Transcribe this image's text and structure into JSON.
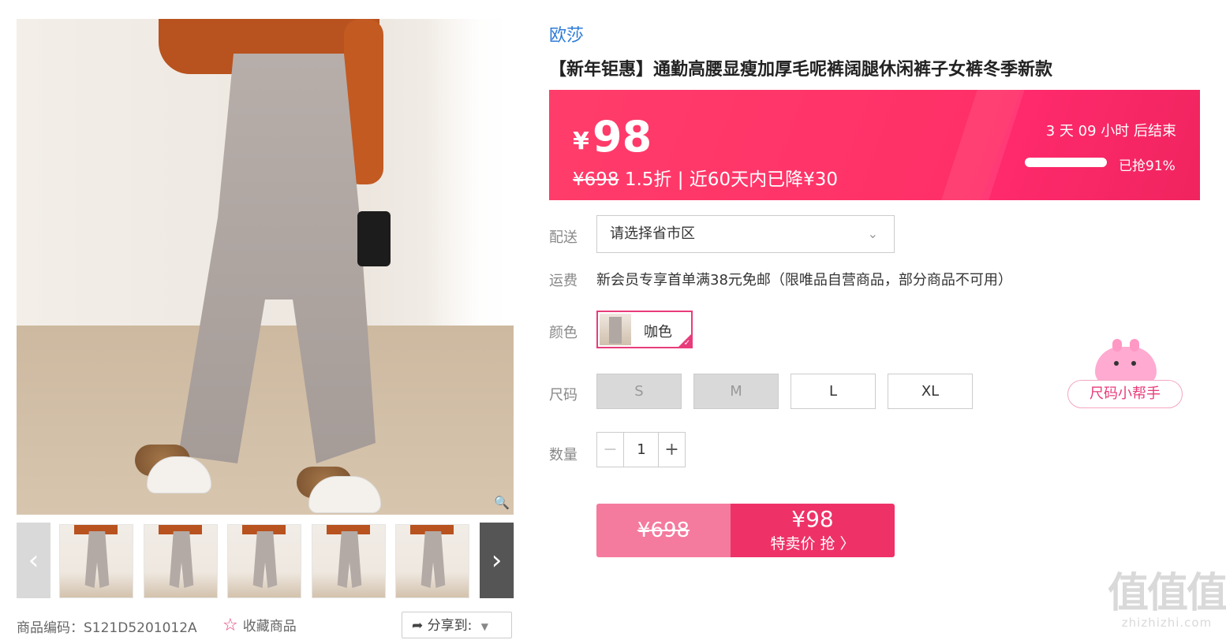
{
  "product": {
    "brand": "欧莎",
    "title": "【新年钜惠】通勤高腰显瘦加厚毛呢裤阔腿休闲裤子女裤冬季新款",
    "sku_label": "商品编码：S121D5201012A",
    "favorite_label": "收藏商品",
    "share_label": "分享到:"
  },
  "price": {
    "currency_symbol": "¥",
    "current": "98",
    "original": "¥698",
    "discount_text": " 1.5折 | 近60天内已降¥30",
    "countdown": "3 天 09 小时 后结束",
    "grabbed_text": "已抢91%",
    "grabbed_ratio": 0.91
  },
  "delivery": {
    "label": "配送",
    "placeholder_value": "请选择省市区"
  },
  "shipping": {
    "label": "运费",
    "text": "新会员专享首单满38元免邮（限唯品自营商品，部分商品不可用）"
  },
  "color": {
    "label": "颜色",
    "options": [
      {
        "name": "咖色",
        "selected": true
      }
    ]
  },
  "size": {
    "label": "尺码",
    "options": [
      {
        "name": "S",
        "available": false
      },
      {
        "name": "M",
        "available": false
      },
      {
        "name": "L",
        "available": true
      },
      {
        "name": "XL",
        "available": true
      }
    ],
    "helper_label": "尺码小帮手"
  },
  "quantity": {
    "label": "数量",
    "minus": "−",
    "value": "1",
    "plus": "+"
  },
  "buy": {
    "original": "¥698",
    "price": "¥98",
    "action": "特卖价 抢 〉"
  },
  "watermark": {
    "big": "值值值",
    "small": "zhizhizhi.com"
  },
  "icons": [
    "zoom-icon",
    "chevron-left-icon",
    "chevron-right-icon",
    "star-icon",
    "share-icon",
    "dropdown-caret-icon",
    "chevron-down-icon",
    "check-icon"
  ]
}
